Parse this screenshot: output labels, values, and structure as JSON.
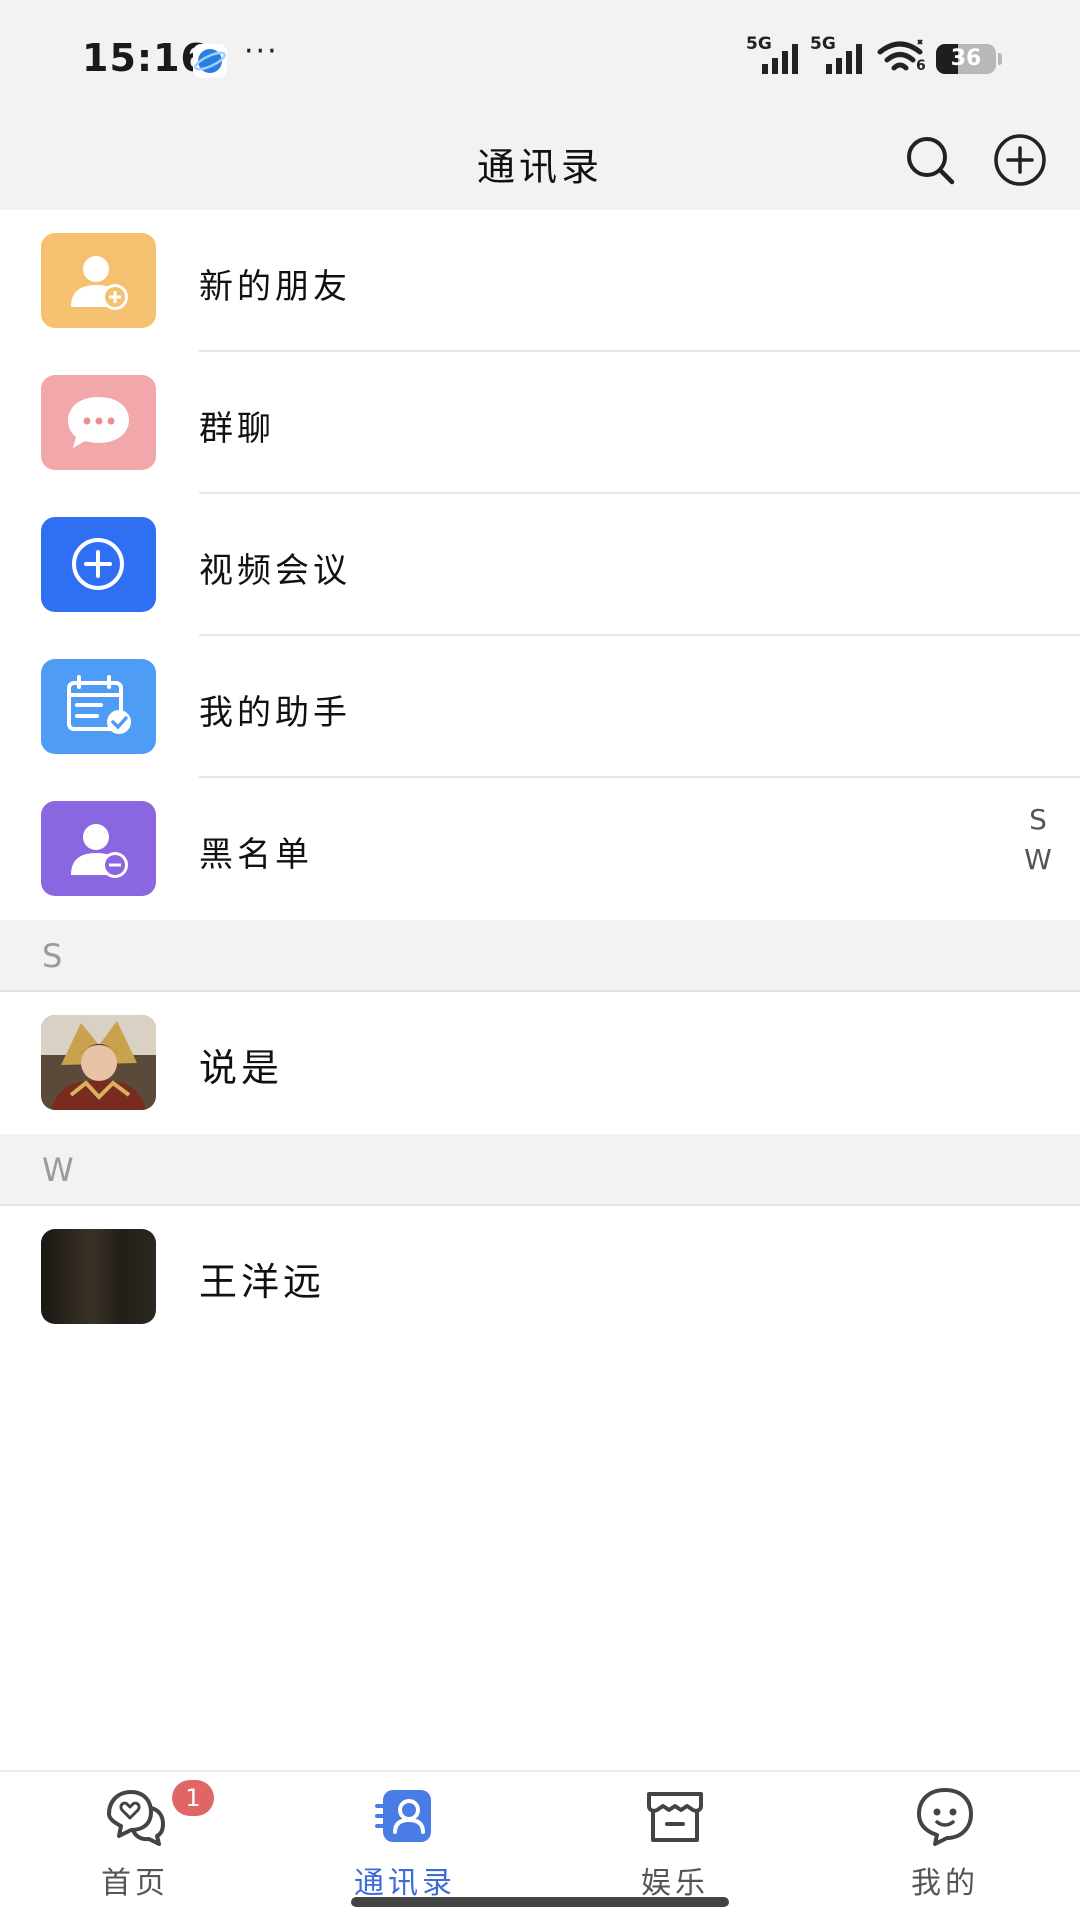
{
  "status_bar": {
    "time": "15:16",
    "more": "···",
    "network_1": "5G",
    "network_2": "5G",
    "wifi_sub": "6",
    "battery": "36",
    "battery_level": 0.36
  },
  "header": {
    "title": "通讯录",
    "search_icon": "search-icon",
    "add_icon": "plus-circle-icon"
  },
  "menu": [
    {
      "label": "新的朋友",
      "icon": "add-friend-icon",
      "color": "#f5c06f"
    },
    {
      "label": "群聊",
      "icon": "chat-bubble-icon",
      "color": "#f2a7aa"
    },
    {
      "label": "视频会议",
      "icon": "plus-circle-icon",
      "color": "#2f6ff3"
    },
    {
      "label": "我的助手",
      "icon": "calendar-check-icon",
      "color": "#4e9cf5"
    },
    {
      "label": "黑名单",
      "icon": "block-user-icon",
      "color": "#8a66e0"
    }
  ],
  "sections": [
    {
      "letter": "S",
      "contacts": [
        {
          "name": "说是",
          "avatar": "avatar-game-character"
        }
      ]
    },
    {
      "letter": "W",
      "contacts": [
        {
          "name": "王洋远",
          "avatar": "avatar-dark"
        }
      ]
    }
  ],
  "index_bar": [
    "S",
    "W"
  ],
  "bottom_nav": [
    {
      "label": "首页",
      "icon": "home-chat-icon",
      "badge": "1",
      "active": false
    },
    {
      "label": "通讯录",
      "icon": "contacts-icon",
      "active": true
    },
    {
      "label": "娱乐",
      "icon": "store-icon",
      "active": false
    },
    {
      "label": "我的",
      "icon": "profile-bubble-icon",
      "active": false
    }
  ],
  "colors": {
    "accent": "#3d6bd8",
    "badge": "#e06666",
    "header_bg": "#f2f2f2"
  }
}
